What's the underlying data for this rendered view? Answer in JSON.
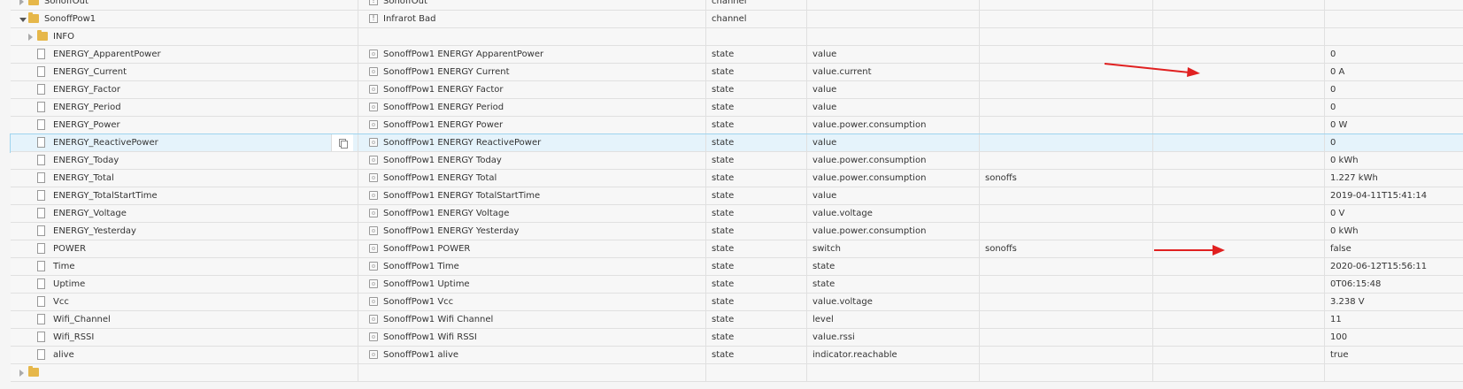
{
  "rows": [
    {
      "id": "SonoffOut",
      "name": "SonoffOut",
      "type": "channel",
      "role": "",
      "room": "",
      "func": "",
      "value": "",
      "kind": "folder",
      "level": 1,
      "open": false,
      "icon": "channel-icon"
    },
    {
      "id": "SonoffPow1",
      "name": "Infrarot Bad",
      "type": "channel",
      "role": "",
      "room": "",
      "func": "",
      "value": "",
      "kind": "folder",
      "level": 1,
      "open": true,
      "icon": "channel-icon"
    },
    {
      "id": "INFO",
      "name": "",
      "type": "",
      "role": "",
      "room": "",
      "func": "",
      "value": "",
      "kind": "folder",
      "level": 2,
      "open": false,
      "icon": ""
    },
    {
      "id": "ENERGY_ApparentPower",
      "name": "SonoffPow1 ENERGY ApparentPower",
      "type": "state",
      "role": "value",
      "room": "",
      "func": "",
      "value": "0",
      "kind": "file",
      "level": 2
    },
    {
      "id": "ENERGY_Current",
      "name": "SonoffPow1 ENERGY Current",
      "type": "state",
      "role": "value.current",
      "room": "",
      "func": "",
      "value": "0 A",
      "kind": "file",
      "level": 2
    },
    {
      "id": "ENERGY_Factor",
      "name": "SonoffPow1 ENERGY Factor",
      "type": "state",
      "role": "value",
      "room": "",
      "func": "",
      "value": "0",
      "kind": "file",
      "level": 2
    },
    {
      "id": "ENERGY_Period",
      "name": "SonoffPow1 ENERGY Period",
      "type": "state",
      "role": "value",
      "room": "",
      "func": "",
      "value": "0",
      "kind": "file",
      "level": 2
    },
    {
      "id": "ENERGY_Power",
      "name": "SonoffPow1 ENERGY Power",
      "type": "state",
      "role": "value.power.consumption",
      "room": "",
      "func": "",
      "value": "0 W",
      "kind": "file",
      "level": 2
    },
    {
      "id": "ENERGY_ReactivePower",
      "name": "SonoffPow1 ENERGY ReactivePower",
      "type": "state",
      "role": "value",
      "room": "",
      "func": "",
      "value": "0",
      "kind": "file",
      "level": 2,
      "highlight": true
    },
    {
      "id": "ENERGY_Today",
      "name": "SonoffPow1 ENERGY Today",
      "type": "state",
      "role": "value.power.consumption",
      "room": "",
      "func": "",
      "value": "0 kWh",
      "kind": "file",
      "level": 2
    },
    {
      "id": "ENERGY_Total",
      "name": "SonoffPow1 ENERGY Total",
      "type": "state",
      "role": "value.power.consumption",
      "room": "sonoffs",
      "func": "",
      "value": "1.227 kWh",
      "kind": "file",
      "level": 2
    },
    {
      "id": "ENERGY_TotalStartTime",
      "name": "SonoffPow1 ENERGY TotalStartTime",
      "type": "state",
      "role": "value",
      "room": "",
      "func": "",
      "value": "2019-04-11T15:41:14",
      "kind": "file",
      "level": 2
    },
    {
      "id": "ENERGY_Voltage",
      "name": "SonoffPow1 ENERGY Voltage",
      "type": "state",
      "role": "value.voltage",
      "room": "",
      "func": "",
      "value": "0 V",
      "kind": "file",
      "level": 2
    },
    {
      "id": "ENERGY_Yesterday",
      "name": "SonoffPow1 ENERGY Yesterday",
      "type": "state",
      "role": "value.power.consumption",
      "room": "",
      "func": "",
      "value": "0 kWh",
      "kind": "file",
      "level": 2
    },
    {
      "id": "POWER",
      "name": "SonoffPow1 POWER",
      "type": "state",
      "role": "switch",
      "room": "sonoffs",
      "func": "",
      "value": "false",
      "kind": "file",
      "level": 2
    },
    {
      "id": "Time",
      "name": "SonoffPow1 Time",
      "type": "state",
      "role": "state",
      "room": "",
      "func": "",
      "value": "2020-06-12T15:56:11",
      "kind": "file",
      "level": 2
    },
    {
      "id": "Uptime",
      "name": "SonoffPow1 Uptime",
      "type": "state",
      "role": "state",
      "room": "",
      "func": "",
      "value": "0T06:15:48",
      "kind": "file",
      "level": 2
    },
    {
      "id": "Vcc",
      "name": "SonoffPow1 Vcc",
      "type": "state",
      "role": "value.voltage",
      "room": "",
      "func": "",
      "value": "3.238 V",
      "kind": "file",
      "level": 2
    },
    {
      "id": "Wifi_Channel",
      "name": "SonoffPow1 Wifi Channel",
      "type": "state",
      "role": "level",
      "room": "",
      "func": "",
      "value": "11",
      "kind": "file",
      "level": 2
    },
    {
      "id": "Wifi_RSSI",
      "name": "SonoffPow1 Wifi RSSI",
      "type": "state",
      "role": "value.rssi",
      "room": "",
      "func": "",
      "value": "100",
      "kind": "file",
      "level": 2
    },
    {
      "id": "alive",
      "name": "SonoffPow1 alive",
      "type": "state",
      "role": "indicator.reachable",
      "room": "",
      "func": "",
      "value": "true",
      "kind": "file",
      "level": 2
    },
    {
      "id": "",
      "name": "",
      "type": "",
      "role": "",
      "room": "",
      "func": "",
      "value": "",
      "kind": "folder",
      "level": 1,
      "open": false
    }
  ],
  "colors": {
    "arrow": "#e02020",
    "folder": "#e6b74a",
    "highlight": "#e5f3fb"
  }
}
